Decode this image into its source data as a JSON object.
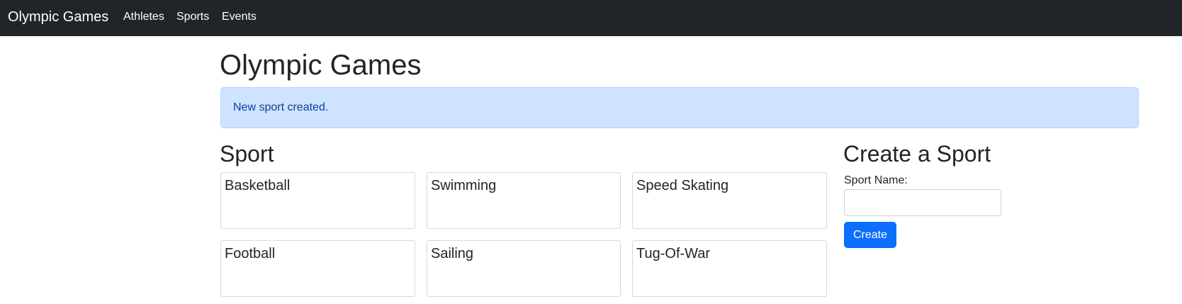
{
  "navbar": {
    "brand": "Olympic Games",
    "links": [
      "Athletes",
      "Sports",
      "Events"
    ]
  },
  "main": {
    "title": "Olympic Games",
    "alert": "New sport created.",
    "sports_heading": "Sport",
    "sports": [
      "Basketball",
      "Swimming",
      "Speed Skating",
      "Football",
      "Sailing",
      "Tug-Of-War"
    ]
  },
  "form": {
    "title": "Create a Sport",
    "label": "Sport Name:",
    "value": "",
    "button": "Create"
  },
  "colors": {
    "navbar_bg": "#212529",
    "alert_bg": "#cfe2ff",
    "alert_text": "#084298",
    "primary": "#0d6efd"
  }
}
